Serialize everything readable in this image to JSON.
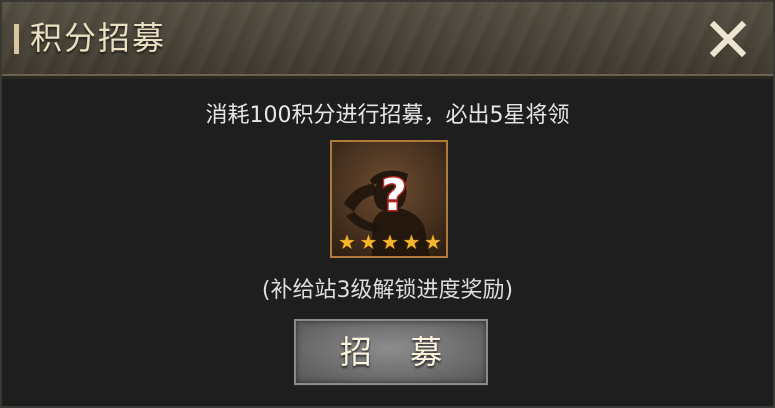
{
  "dialog": {
    "title": "积分招募",
    "close_icon": "close-icon",
    "description": "消耗100积分进行招募，必出5星将领",
    "reward": {
      "portrait_icon": "mystery-general-icon",
      "unknown_mark": "?",
      "stars": 5,
      "star_glyph": "★",
      "star_color": "#f4b62e"
    },
    "note": "(补给站3级解锁进度奖励)",
    "recruit_label": "招 募"
  },
  "colors": {
    "title_text": "#eadfc3",
    "frame_border": "#b07a3a",
    "button_bg": "#7a7a7a"
  }
}
